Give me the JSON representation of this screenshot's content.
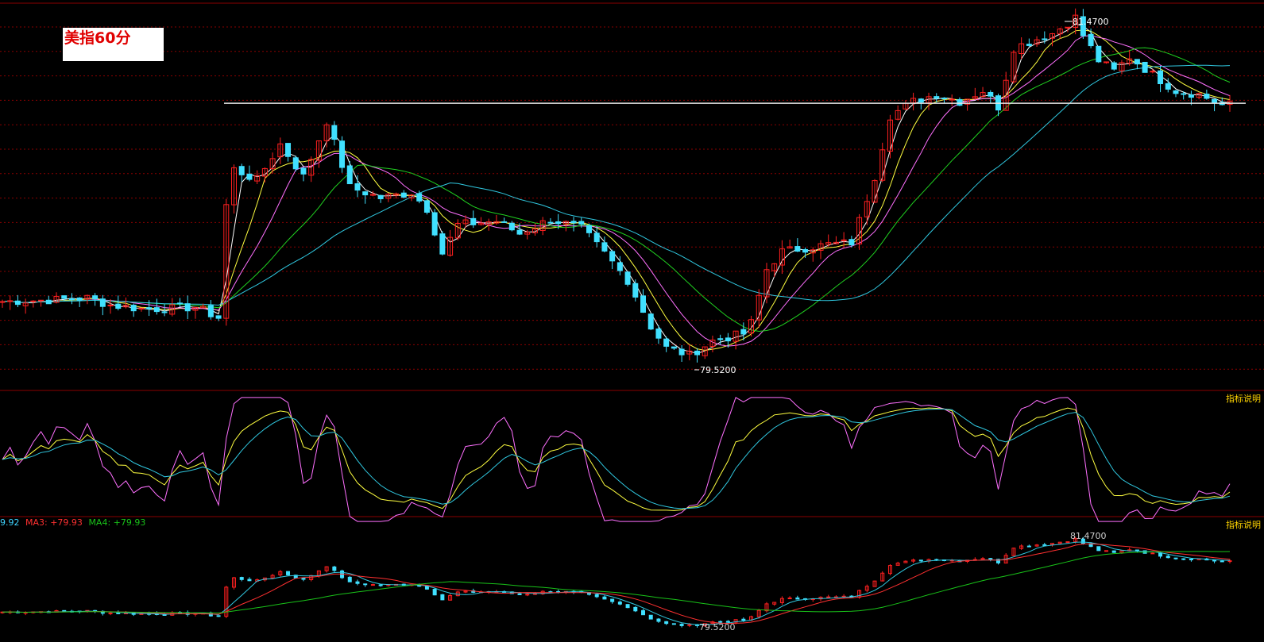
{
  "title": "美指60分",
  "price_labels": {
    "high": "81.4700",
    "low": "79.5200",
    "low_sub": "79.5200",
    "high_sub": "81.4700"
  },
  "tags": {
    "kdj_tag": "指标说明",
    "ma_tag": "指标说明"
  },
  "legend": {
    "ma2": {
      "text": "9.92",
      "color": "#3fd3ff"
    },
    "ma3": {
      "text": "MA3: +79.93",
      "color": "#ff3030"
    },
    "ma4": {
      "text": "MA4: +79.93",
      "color": "#19c219"
    }
  },
  "colors": {
    "grid": "#8a0000",
    "up": "#ff2020",
    "down": "#40e0ff",
    "ma_white": "#ffffff",
    "ma_yellow": "#ffff40",
    "ma_pink": "#ff70ff",
    "ma_green": "#20d020",
    "ma_cyan": "#30c8e0",
    "k": "#ffffff",
    "d": "#ffff40",
    "j": "#ff70ff",
    "kd_cyan": "#30c8e0",
    "sub_red": "#ff3030",
    "sub_cyan": "#30c8e0",
    "sub_green": "#19c219"
  },
  "chart_data": {
    "type": "candlestick",
    "ylim": [
      79.4,
      81.55
    ],
    "resistance": 80.99,
    "high": 81.47,
    "low": 79.52,
    "close_path": [
      [
        0,
        79.88
      ],
      [
        7,
        79.89
      ],
      [
        11,
        79.9
      ],
      [
        14,
        79.86
      ],
      [
        18,
        79.84
      ],
      [
        22,
        79.84
      ],
      [
        25,
        79.85
      ],
      [
        28,
        79.79
      ],
      [
        29,
        80.42
      ],
      [
        30,
        80.62
      ],
      [
        33,
        80.56
      ],
      [
        36,
        80.76
      ],
      [
        39,
        80.58
      ],
      [
        42,
        80.89
      ],
      [
        45,
        80.52
      ],
      [
        49,
        80.46
      ],
      [
        53,
        80.49
      ],
      [
        55,
        80.4
      ],
      [
        57,
        80.15
      ],
      [
        59,
        80.31
      ],
      [
        64,
        80.33
      ],
      [
        67,
        80.26
      ],
      [
        71,
        80.34
      ],
      [
        75,
        80.29
      ],
      [
        78,
        80.15
      ],
      [
        81,
        80.0
      ],
      [
        84,
        79.74
      ],
      [
        86,
        79.62
      ],
      [
        89,
        79.58
      ],
      [
        92,
        79.66
      ],
      [
        94,
        79.68
      ],
      [
        96,
        79.7
      ],
      [
        97,
        79.76
      ],
      [
        99,
        80.06
      ],
      [
        101,
        80.16
      ],
      [
        104,
        80.18
      ],
      [
        107,
        80.2
      ],
      [
        110,
        80.21
      ],
      [
        113,
        80.58
      ],
      [
        115,
        80.92
      ],
      [
        118,
        81.0
      ],
      [
        121,
        81.04
      ],
      [
        124,
        81.0
      ],
      [
        127,
        81.06
      ],
      [
        129,
        80.97
      ],
      [
        131,
        81.3
      ],
      [
        134,
        81.35
      ],
      [
        136,
        81.38
      ],
      [
        139,
        81.47
      ],
      [
        140,
        81.37
      ],
      [
        142,
        81.23
      ],
      [
        144,
        81.17
      ],
      [
        146,
        81.25
      ],
      [
        149,
        81.15
      ],
      [
        152,
        81.06
      ],
      [
        155,
        81.04
      ],
      [
        158,
        80.98
      ]
    ]
  }
}
